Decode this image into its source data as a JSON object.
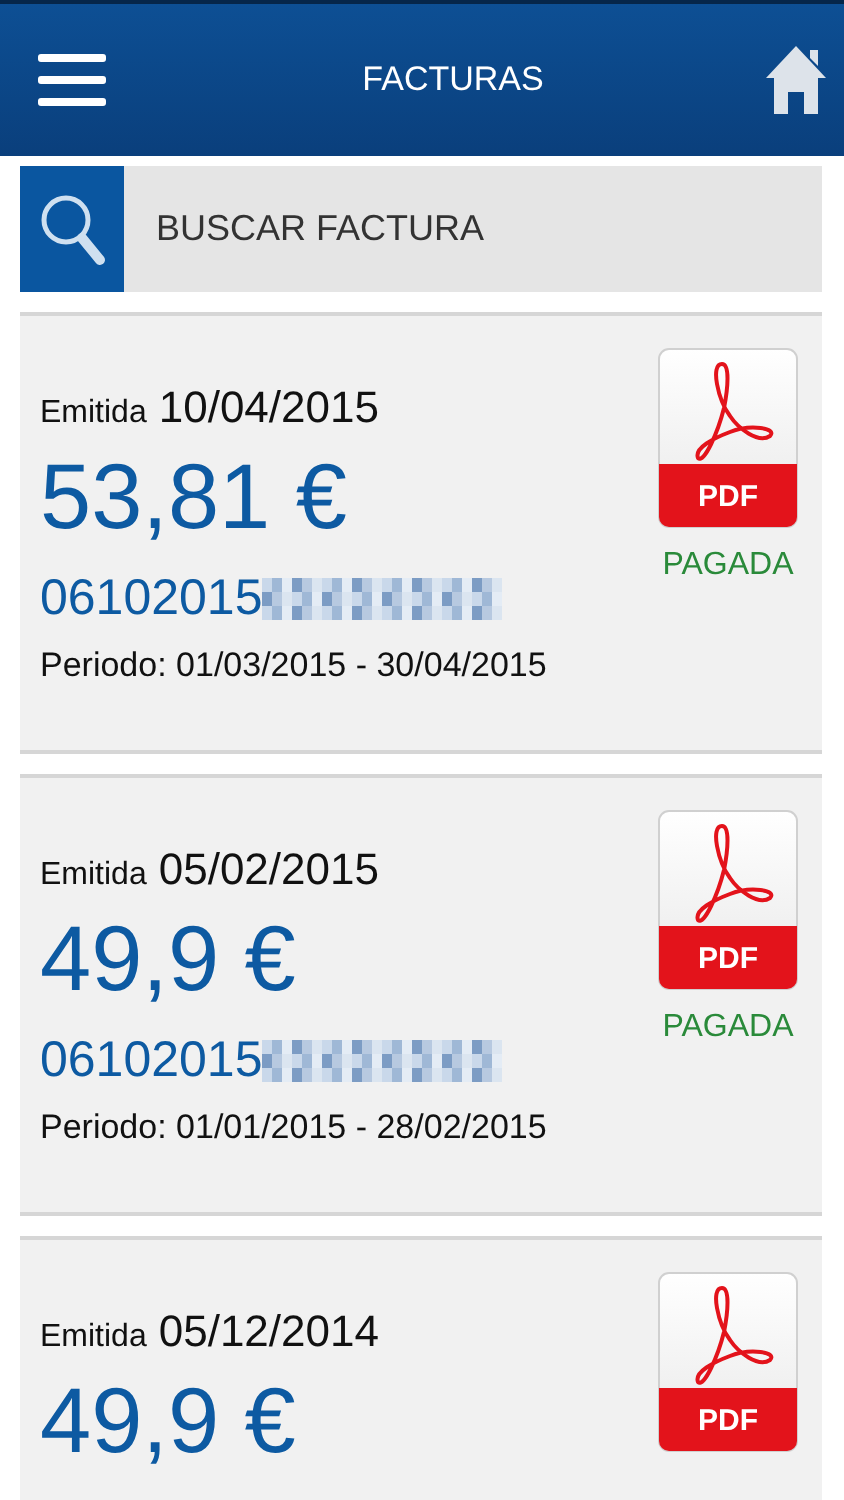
{
  "header": {
    "title": "FACTURAS"
  },
  "search": {
    "placeholder": "BUSCAR FACTURA"
  },
  "invoices": [
    {
      "issued_label": "Emitida",
      "date": "10/04/2015",
      "amount": "53,81 €",
      "number": "06102015",
      "number_redacted": true,
      "period": "Periodo: 01/03/2015 - 30/04/2015",
      "pdf_label": "PDF",
      "status": "PAGADA"
    },
    {
      "issued_label": "Emitida",
      "date": "05/02/2015",
      "amount": "49,9 €",
      "number": "06102015",
      "number_redacted": true,
      "period": "Periodo: 01/01/2015 - 28/02/2015",
      "pdf_label": "PDF",
      "status": "PAGADA"
    },
    {
      "issued_label": "Emitida",
      "date": "05/12/2014",
      "amount": "49,9 €",
      "pdf_label": "PDF"
    }
  ]
}
